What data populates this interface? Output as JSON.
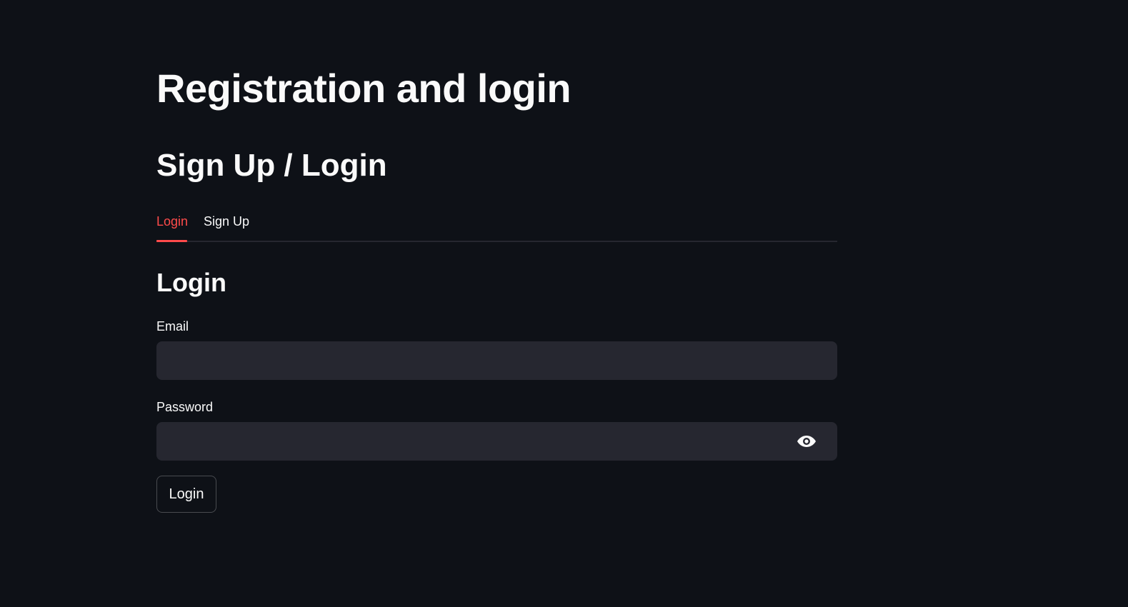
{
  "page": {
    "title": "Registration and login",
    "section_title": "Sign Up / Login"
  },
  "tabs": [
    {
      "label": "Login",
      "active": true
    },
    {
      "label": "Sign Up",
      "active": false
    }
  ],
  "form": {
    "heading": "Login",
    "email": {
      "label": "Email",
      "value": "",
      "placeholder": ""
    },
    "password": {
      "label": "Password",
      "value": "",
      "placeholder": "",
      "toggle_icon": "eye-icon"
    },
    "submit_label": "Login"
  },
  "colors": {
    "background": "#0e1117",
    "text": "#fafafa",
    "accent": "#ff4b4b",
    "input_background": "#262730"
  }
}
